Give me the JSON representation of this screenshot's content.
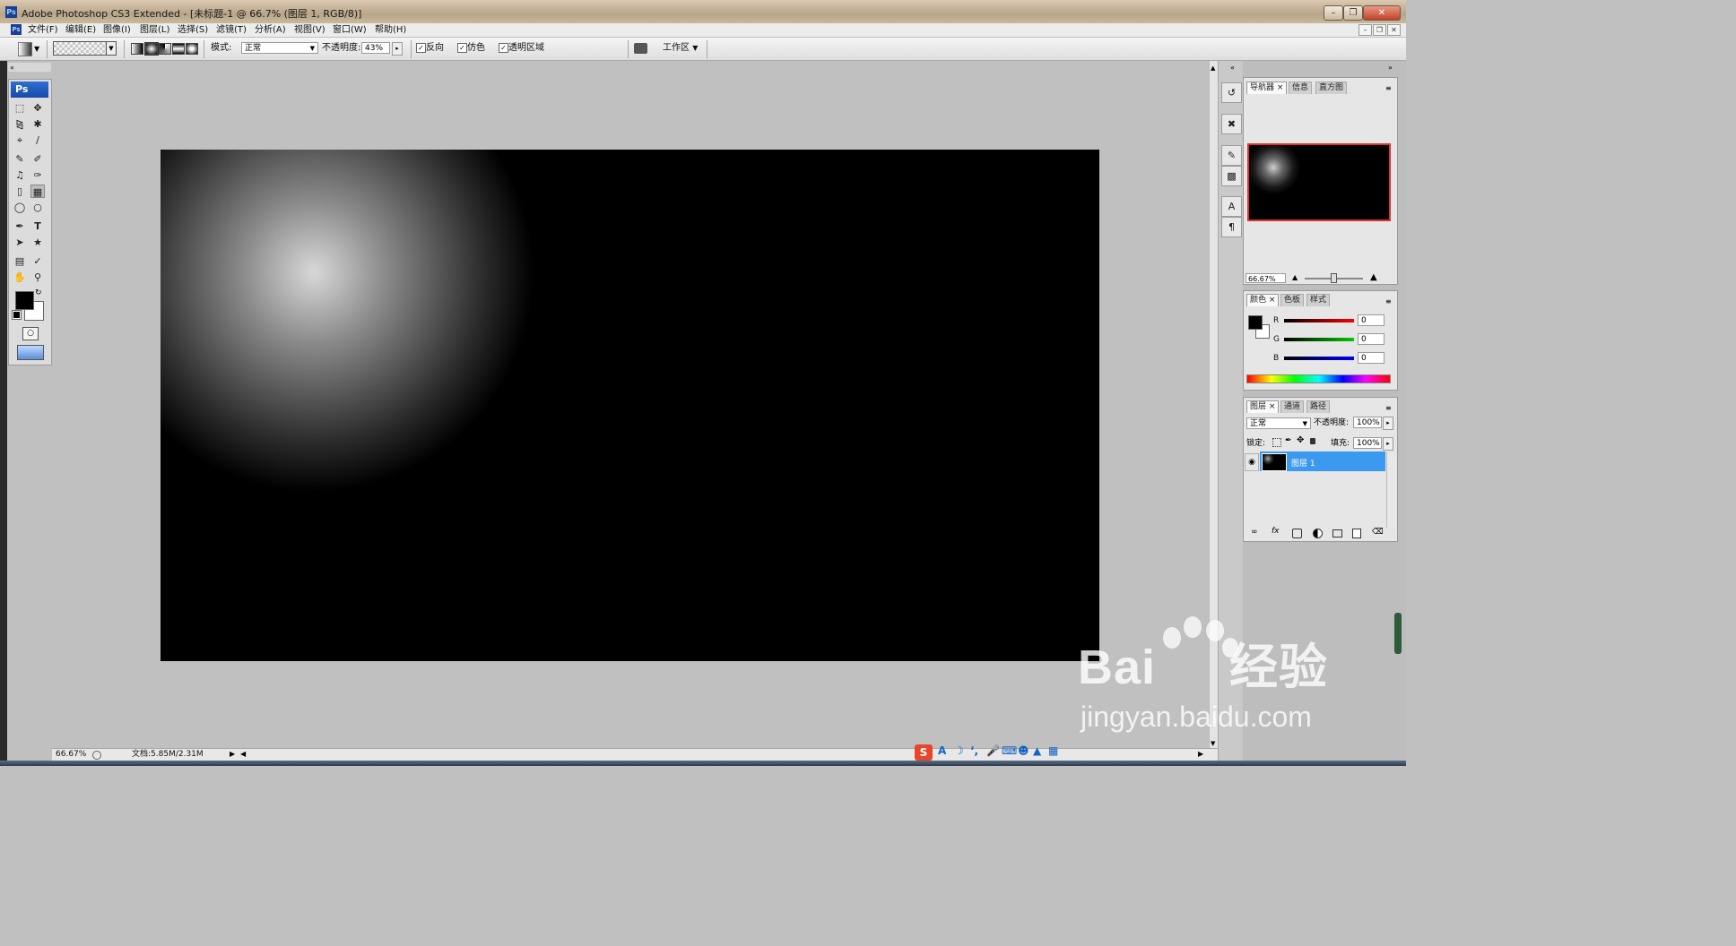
{
  "window": {
    "title": "Adobe Photoshop CS3 Extended - [未标题-1 @ 66.7% (图层 1, RGB/8)]"
  },
  "menu": [
    "文件(F)",
    "编辑(E)",
    "图像(I)",
    "图层(L)",
    "选择(S)",
    "滤镜(T)",
    "分析(A)",
    "视图(V)",
    "窗口(W)",
    "帮助(H)"
  ],
  "options": {
    "mode_label": "模式:",
    "mode_value": "正常",
    "opacity_label": "不透明度:",
    "opacity_value": "43%",
    "reverse_label": "反向",
    "reverse_checked": true,
    "dither_label": "仿色",
    "dither_checked": true,
    "transparency_label": "透明区域",
    "transparency_checked": true,
    "workspace_label": "工作区"
  },
  "toolbox": {
    "logo": "Ps",
    "foreground_color": "#000000",
    "background_color": "#ffffff"
  },
  "navigator": {
    "tabs": [
      "导航器",
      "信息",
      "直方图"
    ],
    "zoom": "66.67%"
  },
  "color_panel": {
    "tabs": [
      "颜色",
      "色板",
      "样式"
    ],
    "channels": [
      {
        "label": "R",
        "value": "0"
      },
      {
        "label": "G",
        "value": "0"
      },
      {
        "label": "B",
        "value": "0"
      }
    ]
  },
  "layers_panel": {
    "tabs": [
      "图层",
      "通道",
      "路径"
    ],
    "blend_mode": "正常",
    "opacity_label": "不透明度:",
    "opacity_value": "100%",
    "lock_label": "锁定:",
    "fill_label": "填充:",
    "fill_value": "100%",
    "layers": [
      {
        "name": "图层 1",
        "selected": true
      }
    ]
  },
  "status": {
    "zoom": "66.67%",
    "doc_info": "文档:5.85M/2.31M"
  },
  "watermark": {
    "main": "Bai",
    "main2": "经验",
    "sub": "jingyan.baidu.com"
  }
}
